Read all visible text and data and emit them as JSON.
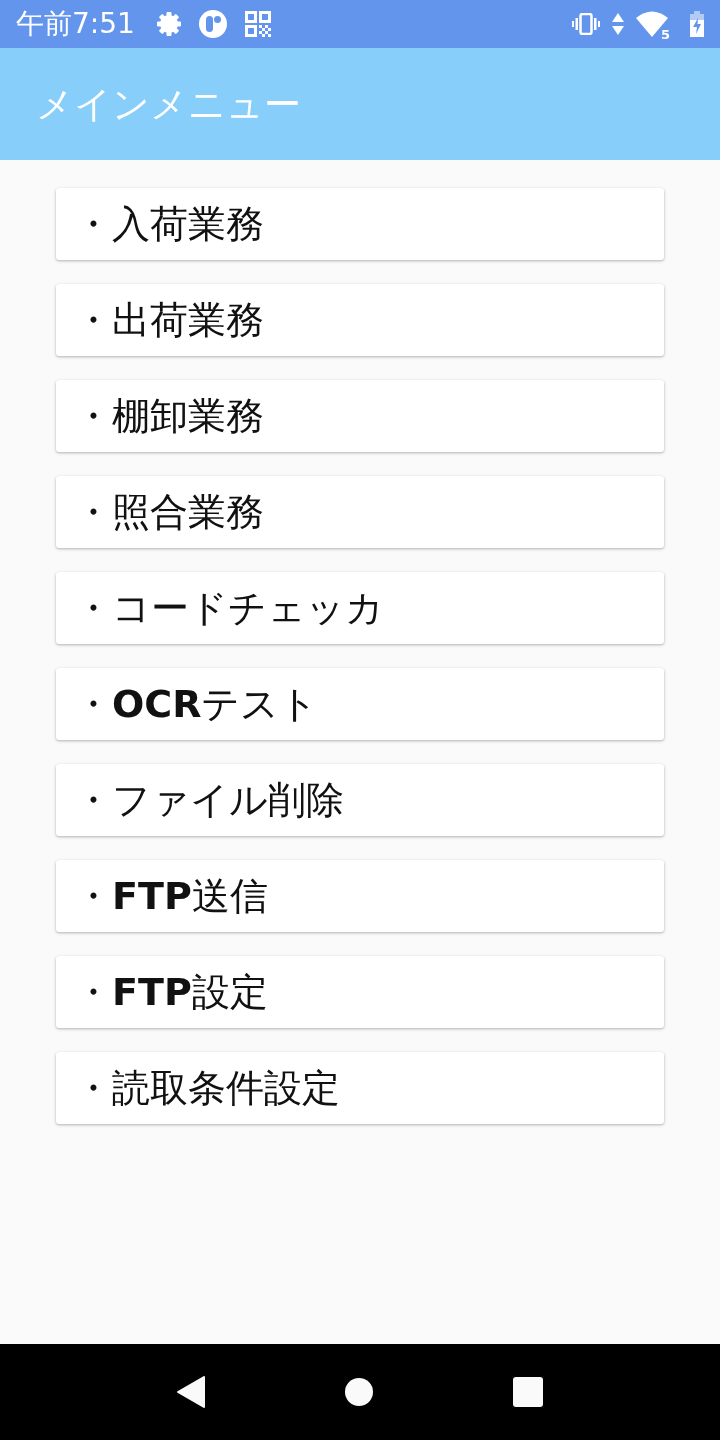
{
  "status_bar": {
    "time": "午前7:51",
    "wifi_badge": "5"
  },
  "app_bar": {
    "title": "メインメニュー"
  },
  "menu": {
    "items": [
      {
        "label": "・入荷業務"
      },
      {
        "label": "・出荷業務"
      },
      {
        "label": "・棚卸業務"
      },
      {
        "label": "・照合業務"
      },
      {
        "label": "・コードチェッカ"
      },
      {
        "label": "・**OCR**テスト"
      },
      {
        "label": "・ファイル削除"
      },
      {
        "label": "・**FTP**送信"
      },
      {
        "label": "・**FTP**設定"
      },
      {
        "label": "・読取条件設定"
      }
    ]
  }
}
